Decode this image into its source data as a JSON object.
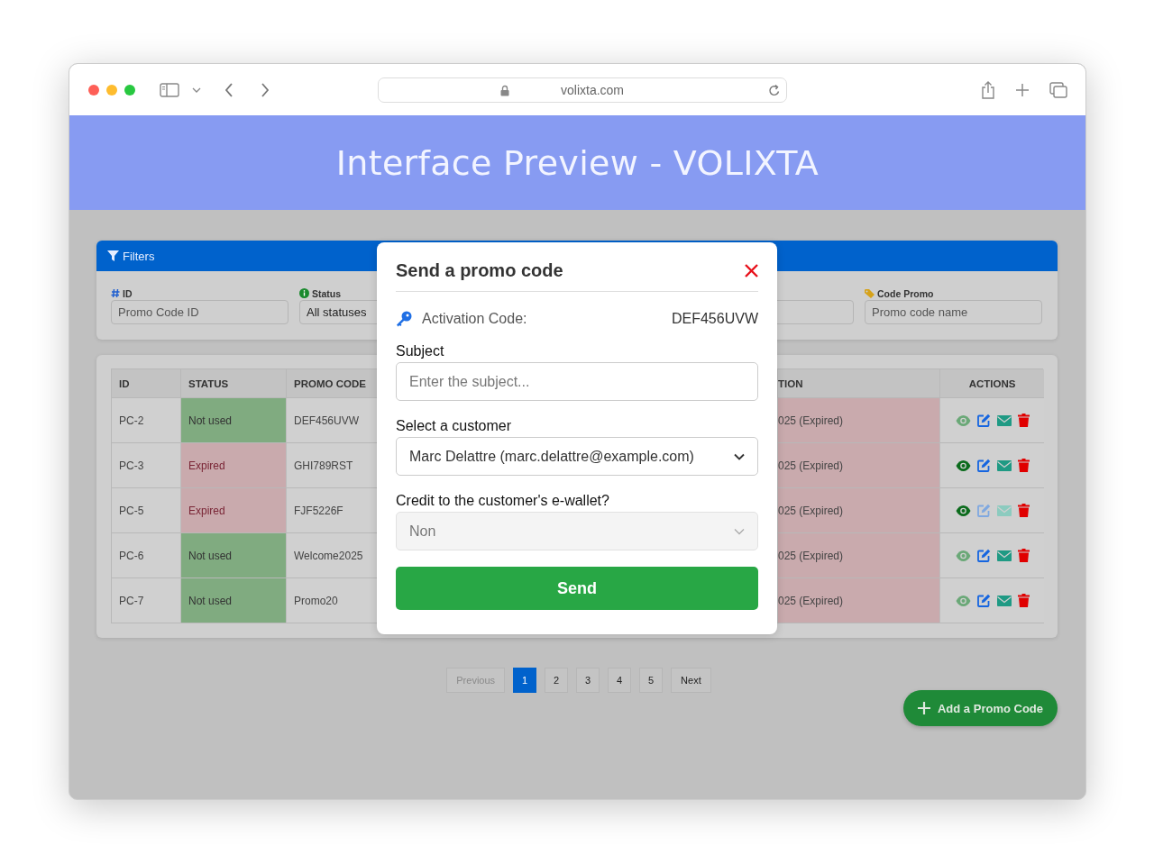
{
  "browser": {
    "url": "volixta.com"
  },
  "header": {
    "title": "Interface Preview - VOLIXTA"
  },
  "filters": {
    "title": "Filters",
    "fields": [
      {
        "kind": "id",
        "label": "ID",
        "placeholder": "Promo Code ID"
      },
      {
        "kind": "status",
        "label": "Status",
        "value": "All statuses"
      },
      {
        "kind": "plain"
      },
      {
        "kind": "code",
        "label": "Code Promo",
        "placeholder": "Promo code name"
      }
    ]
  },
  "table": {
    "columns": [
      {
        "label": "ID"
      },
      {
        "label": "STATUS"
      },
      {
        "label": "PROMO CODE"
      },
      {
        "label": "TION"
      },
      {
        "label": "ACTIONS"
      }
    ],
    "rows": [
      {
        "id": "PC-2",
        "status": "Not used",
        "status_expired": false,
        "promo_code": "DEF456UVW",
        "column_4": "025 (Expired)",
        "expired": true,
        "actions": [
          {
            "kind": "view",
            "disabled": true
          },
          {
            "kind": "edit",
            "disabled": false
          },
          {
            "kind": "mail",
            "disabled": false
          },
          {
            "kind": "delete",
            "disabled": false
          }
        ]
      },
      {
        "id": "PC-3",
        "status": "Expired",
        "status_expired": true,
        "promo_code": "GHI789RST",
        "column_4": "025 (Expired)",
        "expired": true,
        "actions": [
          {
            "kind": "view",
            "disabled": false
          },
          {
            "kind": "edit",
            "disabled": false
          },
          {
            "kind": "mail",
            "disabled": false
          },
          {
            "kind": "delete",
            "disabled": false
          }
        ]
      },
      {
        "id": "PC-5",
        "status": "Expired",
        "status_expired": true,
        "promo_code": "FJF5226F",
        "column_4": "025 (Expired)",
        "expired": true,
        "actions": [
          {
            "kind": "view",
            "disabled": false
          },
          {
            "kind": "edit",
            "disabled": true
          },
          {
            "kind": "mail",
            "disabled": true
          },
          {
            "kind": "delete",
            "disabled": false
          }
        ]
      },
      {
        "id": "PC-6",
        "status": "Not used",
        "status_expired": false,
        "promo_code": "Welcome2025",
        "column_4": "025 (Expired)",
        "expired": true,
        "actions": [
          {
            "kind": "view",
            "disabled": true
          },
          {
            "kind": "edit",
            "disabled": false
          },
          {
            "kind": "mail",
            "disabled": false
          },
          {
            "kind": "delete",
            "disabled": false
          }
        ]
      },
      {
        "id": "PC-7",
        "status": "Not used",
        "status_expired": false,
        "promo_code": "Promo20",
        "column_4": "025 (Expired)",
        "expired": true,
        "actions": [
          {
            "kind": "view",
            "disabled": true
          },
          {
            "kind": "edit",
            "disabled": false
          },
          {
            "kind": "mail",
            "disabled": false
          },
          {
            "kind": "delete",
            "disabled": false
          }
        ]
      }
    ]
  },
  "pagination": {
    "previous": {
      "label": "Previous",
      "disabled": true
    },
    "pages": [
      {
        "label": "1",
        "selected": true
      },
      {
        "label": "2",
        "selected": false
      },
      {
        "label": "3",
        "selected": false
      },
      {
        "label": "4",
        "selected": false
      },
      {
        "label": "5",
        "selected": false
      }
    ],
    "next": {
      "label": "Next",
      "disabled": false
    }
  },
  "add_button": {
    "label": "Add a Promo Code"
  },
  "modal": {
    "title": "Send a promo code",
    "activation_label": "Activation Code:",
    "activation_code": "DEF456UVW",
    "subject": {
      "label": "Subject",
      "placeholder": "Enter the subject..."
    },
    "customer": {
      "label": "Select a customer",
      "value": "Marc Delattre (marc.delattre@example.com)",
      "disabled": false
    },
    "wallet": {
      "label": "Credit to the customer's e-wallet?",
      "value": "Non",
      "disabled": true
    },
    "send_button": {
      "label": "Send"
    }
  }
}
